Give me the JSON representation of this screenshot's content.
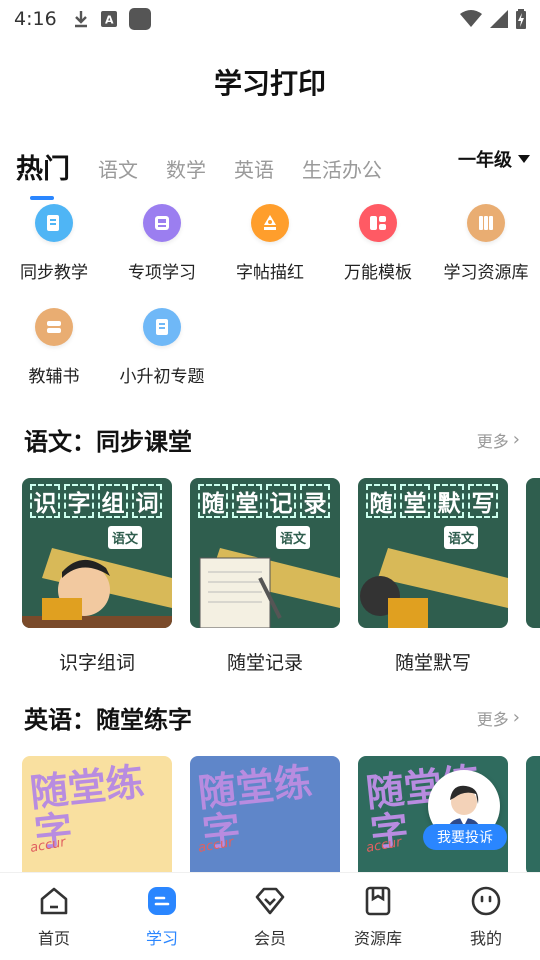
{
  "status_bar": {
    "time": "4:16"
  },
  "page_title": "学习打印",
  "tabs": [
    {
      "label": "热门",
      "active": true
    },
    {
      "label": "语文"
    },
    {
      "label": "数学"
    },
    {
      "label": "英语"
    },
    {
      "label": "生活办公"
    }
  ],
  "grade_select": {
    "value": "一年级"
  },
  "tools": [
    {
      "label": "同步教学",
      "icon": "document-icon",
      "color": "#4fb5f5"
    },
    {
      "label": "专项学习",
      "icon": "tray-icon",
      "color": "#9b7ef0"
    },
    {
      "label": "字帖描红",
      "icon": "pen-nib-icon",
      "color": "#ff9e2c"
    },
    {
      "label": "万能模板",
      "icon": "template-icon",
      "color": "#ff5a64"
    },
    {
      "label": "学习资源库",
      "icon": "books-icon",
      "color": "#e9ad72"
    },
    {
      "label": "教辅书",
      "icon": "book-stack-icon",
      "color": "#e9ad72"
    },
    {
      "label": "小升初专题",
      "icon": "scroll-icon",
      "color": "#6fb8f7"
    }
  ],
  "section_chinese": {
    "title": "语文：同步课堂",
    "more": "更多",
    "cards": [
      {
        "label": "识字组词",
        "board_chars": [
          "识",
          "字",
          "组",
          "词"
        ],
        "tag": "语文"
      },
      {
        "label": "随堂记录",
        "board_chars": [
          "随",
          "堂",
          "记",
          "录"
        ],
        "tag": "语文"
      },
      {
        "label": "随堂默写",
        "board_chars": [
          "随",
          "堂",
          "默",
          "写"
        ],
        "tag": "语文"
      }
    ]
  },
  "section_english": {
    "title": "英语：随堂练字",
    "more": "更多",
    "cards": [
      {
        "art_text": "随堂练字",
        "word": "accur",
        "bg": "#f9e0a0"
      },
      {
        "art_text": "随堂练字",
        "word": "accur",
        "bg": "#5f86c9"
      },
      {
        "art_text": "随堂练字",
        "word": "accur",
        "bg": "#2f6b5e"
      }
    ]
  },
  "complaint_button": "我要投诉",
  "bottom_nav": [
    {
      "label": "首页",
      "icon": "home-icon"
    },
    {
      "label": "学习",
      "icon": "study-icon",
      "active": true
    },
    {
      "label": "会员",
      "icon": "diamond-icon"
    },
    {
      "label": "资源库",
      "icon": "archive-icon"
    },
    {
      "label": "我的",
      "icon": "smiley-icon"
    }
  ]
}
